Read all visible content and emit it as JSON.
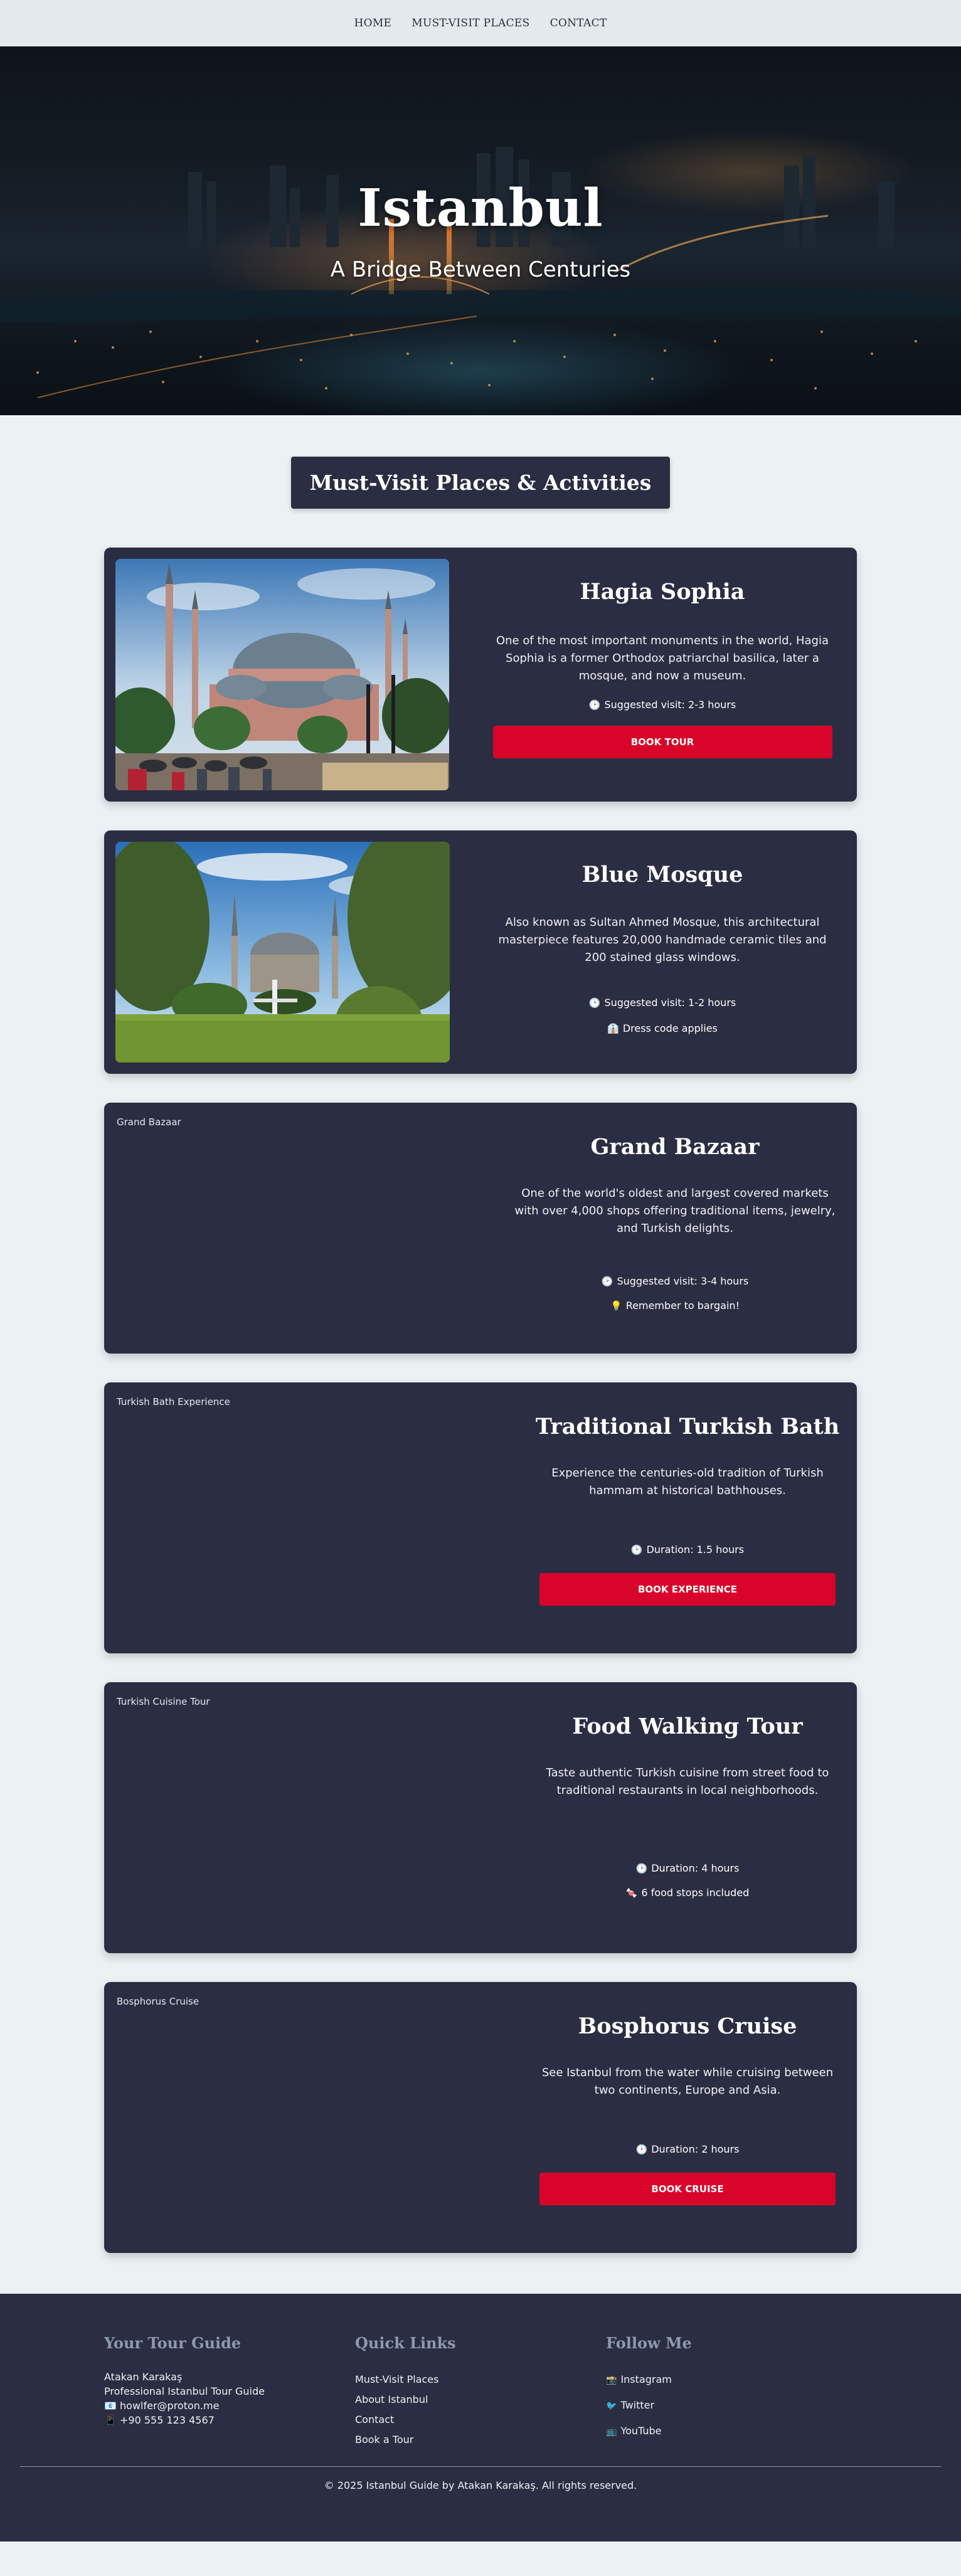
{
  "nav": {
    "items": [
      "HOME",
      "MUST-VISIT PLACES",
      "CONTACT"
    ]
  },
  "hero": {
    "title": "Istanbul",
    "subtitle": "A Bridge Between Centuries"
  },
  "section": {
    "title": "Must-Visit Places & Activities"
  },
  "places": [
    {
      "title": "Hagia Sophia",
      "description": "One of the most important monuments in the world, Hagia Sophia is a former Orthodox patriarchal basilica, later a mosque, and now a museum.",
      "meta": [
        {
          "icon": "clock-icon",
          "glyph": "🕑",
          "text": "Suggested visit: 2-3 hours"
        }
      ],
      "button": "BOOK TOUR"
    },
    {
      "title": "Blue Mosque",
      "description": "Also known as Sultan Ahmed Mosque, this architectural masterpiece features 20,000 handmade ceramic tiles and 200 stained glass windows.",
      "meta": [
        {
          "icon": "clock-icon",
          "glyph": "🕑",
          "text": "Suggested visit: 1-2 hours"
        },
        {
          "icon": "dress-code-icon",
          "glyph": "👔",
          "text": "Dress code applies"
        }
      ]
    },
    {
      "image_alt": "Grand Bazaar",
      "title": "Grand Bazaar",
      "description": "One of the world's oldest and largest covered markets with over 4,000 shops offering traditional items, jewelry, and Turkish delights.",
      "meta": [
        {
          "icon": "clock-icon",
          "glyph": "🕑",
          "text": "Suggested visit: 3-4 hours"
        },
        {
          "icon": "lightbulb-icon",
          "glyph": "💡",
          "text": "Remember to bargain!"
        }
      ]
    },
    {
      "image_alt": "Turkish Bath Experience",
      "title": "Traditional Turkish Bath",
      "description": "Experience the centuries-old tradition of Turkish hammam at historical bathhouses.",
      "meta": [
        {
          "icon": "clock-icon",
          "glyph": "🕑",
          "text": "Duration: 1.5 hours"
        }
      ],
      "button": "BOOK EXPERIENCE"
    },
    {
      "image_alt": "Turkish Cuisine Tour",
      "title": "Food Walking Tour",
      "description": "Taste authentic Turkish cuisine from street food to traditional restaurants in local neighborhoods.",
      "meta": [
        {
          "icon": "clock-icon",
          "glyph": "🕑",
          "text": "Duration: 4 hours"
        },
        {
          "icon": "food-icon",
          "glyph": "🍬",
          "text": "6 food stops included"
        }
      ]
    },
    {
      "image_alt": "Bosphorus Cruise",
      "title": "Bosphorus Cruise",
      "description": "See Istanbul from the water while cruising between two continents, Europe and Asia.",
      "meta": [
        {
          "icon": "clock-icon",
          "glyph": "🕑",
          "text": "Duration: 2 hours"
        }
      ],
      "button": "BOOK CRUISE"
    }
  ],
  "footer": {
    "guide": {
      "heading": "Your Tour Guide",
      "name": "Atakan Karakaş",
      "role": "Professional Istanbul Tour Guide",
      "email_icon": "📧",
      "email": "howlfer@proton.me",
      "phone_icon": "📱",
      "phone": "+90 555 123 4567"
    },
    "quick_links": {
      "heading": "Quick Links",
      "items": [
        "Must-Visit Places",
        "About Istanbul",
        "Contact",
        "Book a Tour"
      ]
    },
    "follow": {
      "heading": "Follow Me",
      "items": [
        {
          "icon": "instagram-icon",
          "glyph": "📸",
          "label": "Instagram"
        },
        {
          "icon": "twitter-icon",
          "glyph": "🐦",
          "label": "Twitter"
        },
        {
          "icon": "youtube-icon",
          "glyph": "📺",
          "label": "YouTube"
        }
      ]
    },
    "copyright": "© 2025 Istanbul Guide by Atakan Karakaş. All rights reserved."
  },
  "colors": {
    "card_bg": "#2b2d42",
    "accent": "#d90429",
    "muted": "#8d99ae",
    "page_bg": "#ecf1f4"
  }
}
